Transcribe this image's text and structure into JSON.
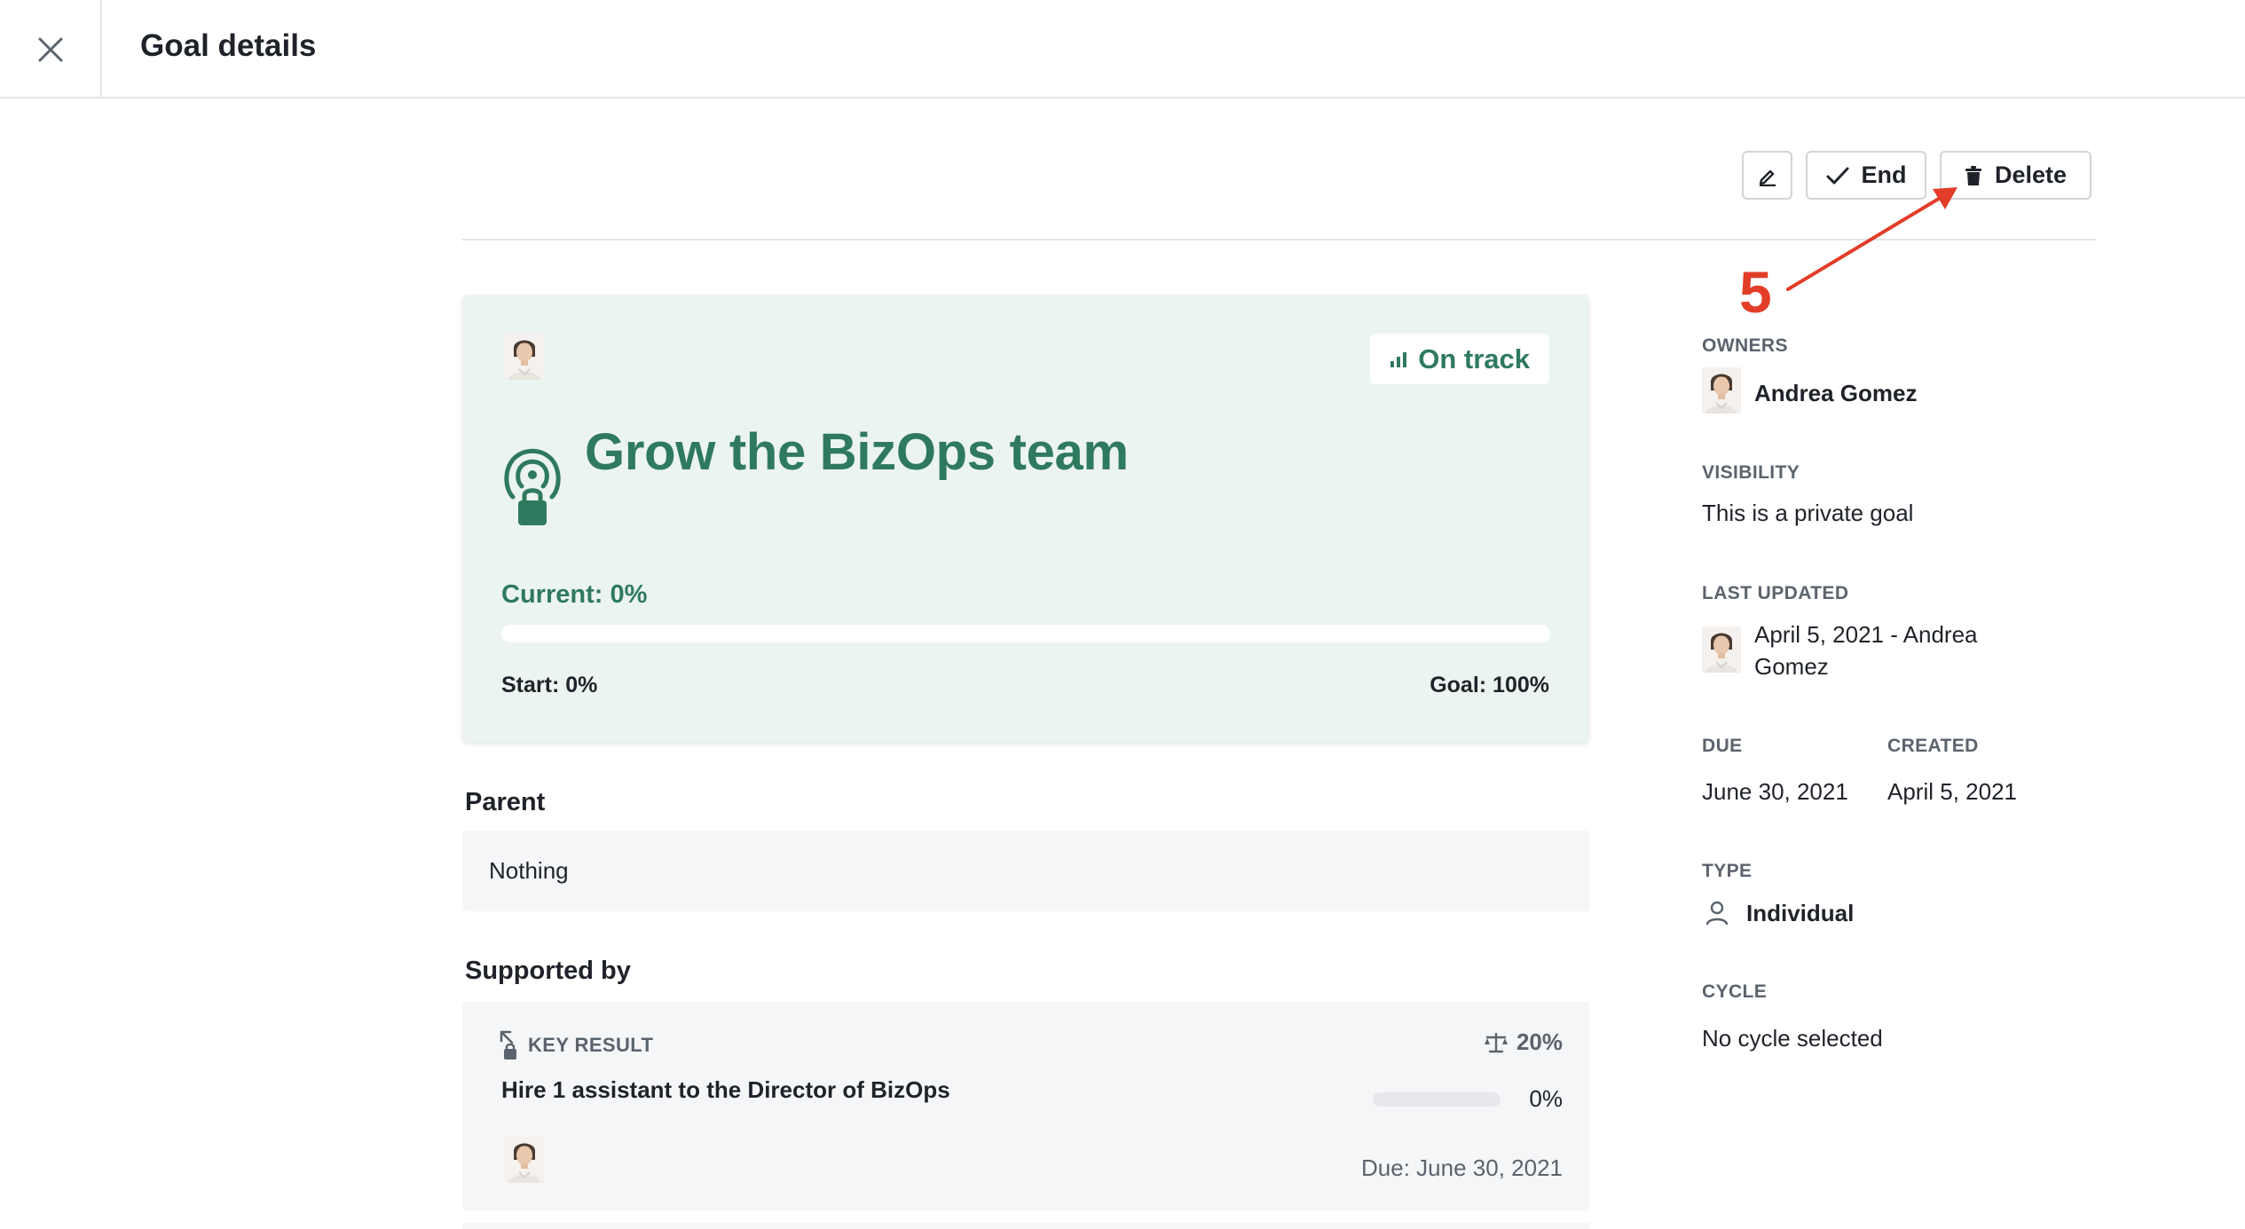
{
  "header": {
    "title": "Goal details",
    "close_icon": "close-icon"
  },
  "toolbar": {
    "edit_icon": "pencil-icon",
    "end_label": "End",
    "delete_label": "Delete"
  },
  "annotation": {
    "step_number": "5",
    "color": "#e23d28"
  },
  "goal": {
    "status": "On track",
    "title": "Grow the BizOps team",
    "current_label": "Current: 0%",
    "progress": 0,
    "start_label": "Start: 0%",
    "goal_label": "Goal: 100%",
    "accent_color": "#2f7a5e",
    "card_background": "#ebf4f0"
  },
  "parent": {
    "title": "Parent",
    "value": "Nothing"
  },
  "supported_by": {
    "title": "Supported by",
    "items": [
      {
        "type_label": "KEY RESULT",
        "weight": "20%",
        "title": "Hire 1 assistant to the Director of BizOps",
        "progress": 0,
        "progress_label": "0%",
        "due": "Due: June 30, 2021"
      }
    ]
  },
  "sidebar": {
    "owners_label": "OWNERS",
    "owner_name": "Andrea Gomez",
    "visibility_label": "VISIBILITY",
    "visibility_value": "This is a private goal",
    "last_updated_label": "LAST UPDATED",
    "last_updated_line1": "April 5, 2021 - Andrea",
    "last_updated_line2": "Gomez",
    "due_label": "DUE",
    "due_value": "June 30, 2021",
    "created_label": "CREATED",
    "created_value": "April 5, 2021",
    "type_label": "TYPE",
    "type_value": "Individual",
    "cycle_label": "CYCLE",
    "cycle_value": "No cycle selected"
  }
}
